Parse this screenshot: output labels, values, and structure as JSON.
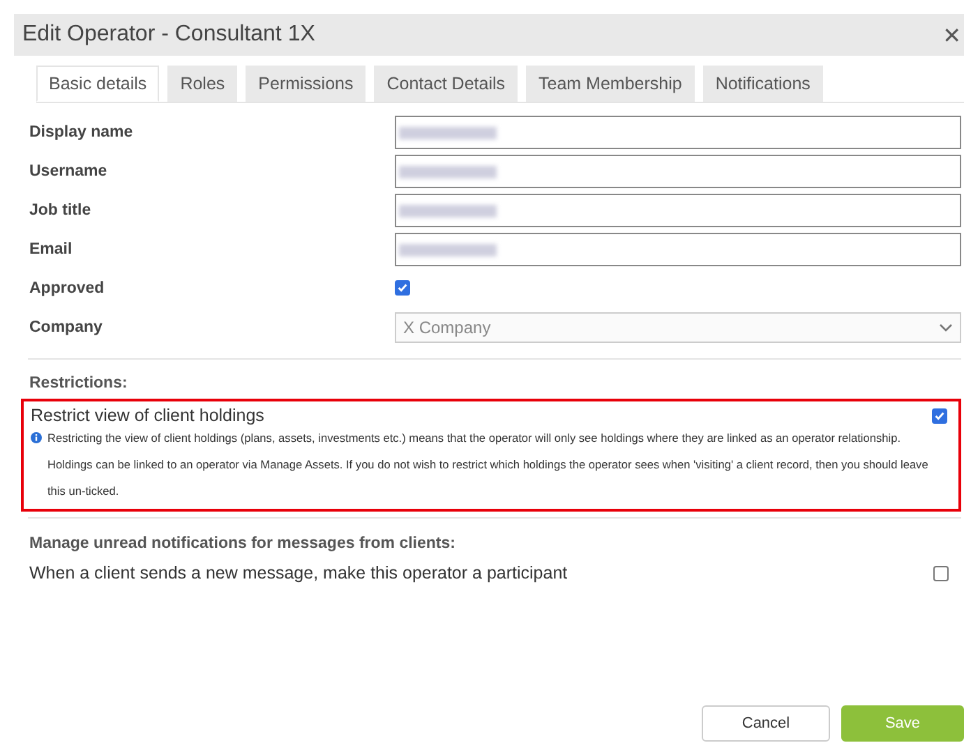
{
  "window": {
    "title": "Edit Operator - Consultant 1X",
    "close": "✕"
  },
  "tabs": [
    {
      "label": "Basic details",
      "selected": true
    },
    {
      "label": "Roles",
      "selected": false
    },
    {
      "label": "Permissions",
      "selected": false
    },
    {
      "label": "Contact Details",
      "selected": false
    },
    {
      "label": "Team Membership",
      "selected": false
    },
    {
      "label": "Notifications",
      "selected": false
    }
  ],
  "fields": [
    {
      "label": "Display name",
      "kind": "text",
      "redacted": true
    },
    {
      "label": "Username",
      "kind": "text",
      "redacted": true
    },
    {
      "label": "Job title",
      "kind": "text",
      "redacted": true
    },
    {
      "label": "Email",
      "kind": "text",
      "redacted": true
    },
    {
      "label": "Approved",
      "kind": "checkbox",
      "checked": true
    },
    {
      "label": "Company",
      "kind": "select",
      "value": "X Company",
      "disabled": true
    }
  ],
  "restrictions": {
    "heading": "Restrictions:",
    "label": "Restrict view of client holdings",
    "checked": true,
    "highlighted": true,
    "info": "Restricting the view of client holdings (plans, assets, investments etc.) means that the operator will only see holdings where they are linked as an operator relationship. Holdings can be linked to an operator via Manage Assets. If you do not wish to restrict which holdings the operator sees when 'visiting' a client record, then you should leave this un-ticked."
  },
  "notifications": {
    "heading": "Manage unread notifications for messages from clients:",
    "label": "When a client sends a new message, make this operator a participant",
    "checked": false
  },
  "buttons": [
    {
      "label": "Cancel",
      "kind": "secondary"
    },
    {
      "label": "Save",
      "kind": "primary"
    }
  ]
}
